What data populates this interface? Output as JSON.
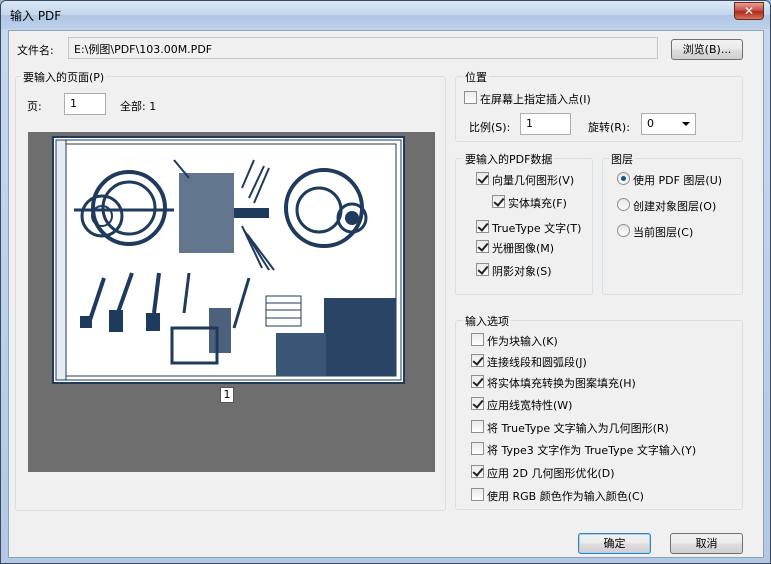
{
  "window": {
    "title": "输入 PDF",
    "close_glyph": "✕"
  },
  "file": {
    "label": "文件名:",
    "path": "E:\\例图\\PDF\\103.00M.PDF",
    "browse_label": "浏览(B)..."
  },
  "page_group": {
    "title": "要输入的页面(P)",
    "page_label": "页:",
    "page_value": "1",
    "total_label": "全部: 1",
    "thumbnail_page_label": "1"
  },
  "position_group": {
    "title": "位置",
    "specify_on_screen_label": "在屏幕上指定插入点(I)",
    "specify_on_screen_checked": false,
    "scale_label": "比例(S):",
    "scale_value": "1",
    "rotation_label": "旋转(R):",
    "rotation_value": "0"
  },
  "pdf_data_group": {
    "title": "要输入的PDF数据",
    "items": [
      {
        "label": "向量几何图形(V)",
        "checked": true
      },
      {
        "label": "实体填充(F)",
        "checked": true
      },
      {
        "label": "TrueType 文字(T)",
        "checked": true
      },
      {
        "label": "光栅图像(M)",
        "checked": true
      },
      {
        "label": "阴影对象(S)",
        "checked": true
      }
    ]
  },
  "layers_group": {
    "title": "图层",
    "options": [
      {
        "label": "使用 PDF 图层(U)",
        "selected": true
      },
      {
        "label": "创建对象图层(O)",
        "selected": false
      },
      {
        "label": "当前图层(C)",
        "selected": false
      }
    ]
  },
  "import_options_group": {
    "title": "输入选项",
    "items": [
      {
        "label": "作为块输入(K)",
        "checked": false
      },
      {
        "label": "连接线段和圆弧段(J)",
        "checked": true
      },
      {
        "label": "将实体填充转换为图案填充(H)",
        "checked": true
      },
      {
        "label": "应用线宽特性(W)",
        "checked": true
      },
      {
        "label": "将 TrueType 文字输入为几何图形(R)",
        "checked": false
      },
      {
        "label": "将 Type3 文字作为 TrueType 文字输入(Y)",
        "checked": false
      },
      {
        "label": "应用 2D 几何图形优化(D)",
        "checked": true
      },
      {
        "label": "使用 RGB 颜色作为输入颜色(C)",
        "checked": false
      }
    ]
  },
  "buttons": {
    "ok_label": "确定",
    "cancel_label": "取消"
  },
  "colors": {
    "drawing_ink": "#1e3a5c",
    "preview_bg": "#6e6e6e",
    "title_bar": "#c2d5ee"
  }
}
